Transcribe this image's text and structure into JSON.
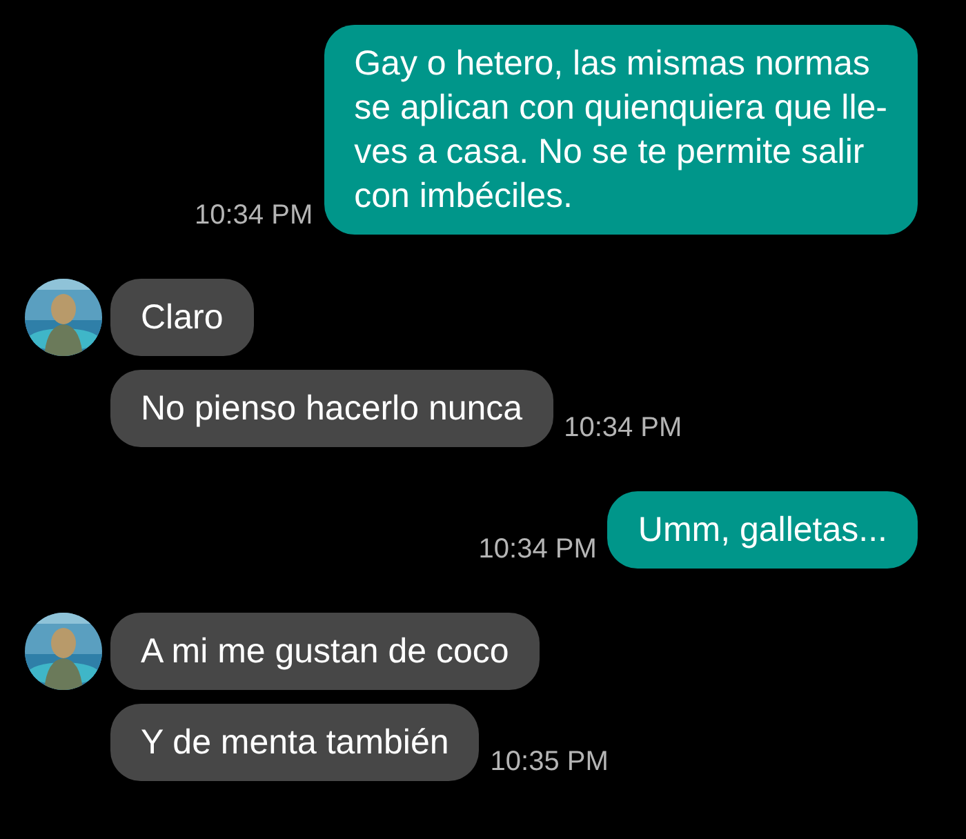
{
  "messages": [
    {
      "kind": "outgoing",
      "bubbles": [
        {
          "lines": [
            "Gay o hetero, las mismas normas",
            "se aplican con quienquiera que lle-",
            "ves a casa. No se te permite salir",
            "con imbéciles."
          ]
        }
      ],
      "time": "10:34 PM"
    },
    {
      "kind": "incoming",
      "bubbles": [
        {
          "lines": [
            "Claro"
          ]
        },
        {
          "lines": [
            "No pienso hacerlo nunca"
          ]
        }
      ],
      "time": "10:34 PM"
    },
    {
      "kind": "outgoing",
      "bubbles": [
        {
          "lines": [
            "Umm, galletas..."
          ]
        }
      ],
      "time": "10:34 PM"
    },
    {
      "kind": "incoming",
      "bubbles": [
        {
          "lines": [
            "A mi me gustan de coco"
          ]
        },
        {
          "lines": [
            "Y de menta también"
          ]
        }
      ],
      "time": "10:35 PM"
    }
  ]
}
